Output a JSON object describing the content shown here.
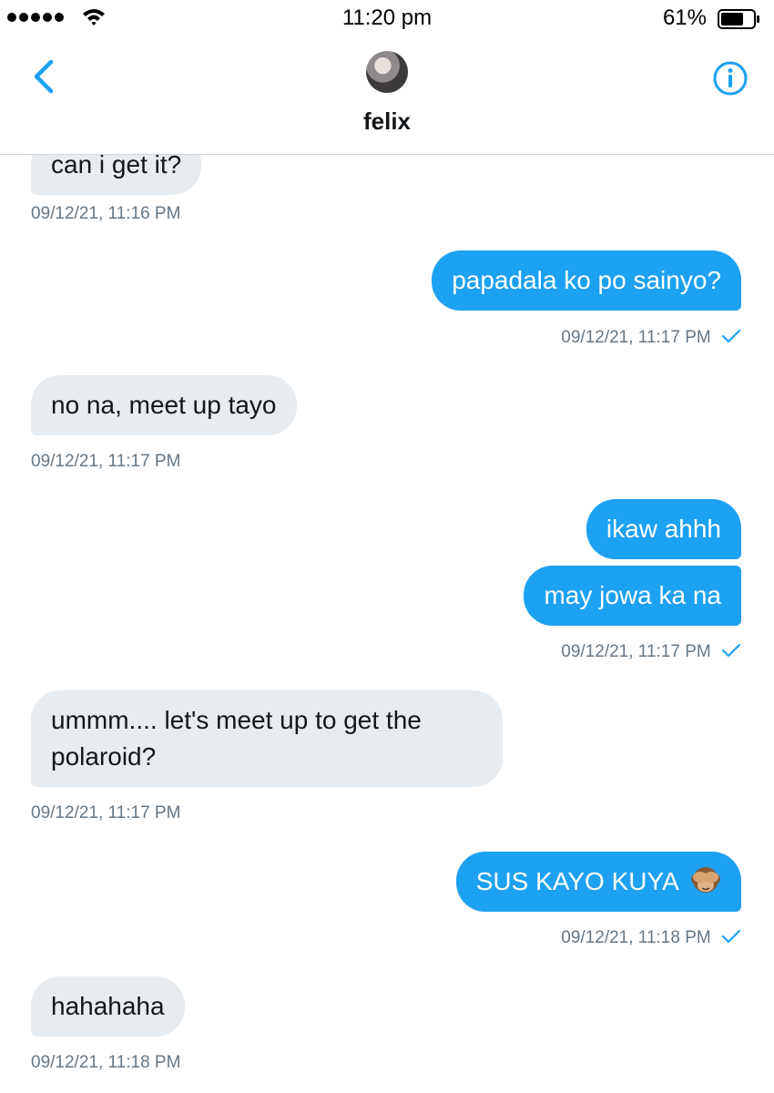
{
  "status_bar": {
    "time": "11:20 pm",
    "battery": "61%",
    "icons": [
      "signal-dots-icon",
      "wifi-icon",
      "battery-icon"
    ]
  },
  "header": {
    "contact_name": "felix",
    "icons": [
      "back-chevron-icon",
      "avatar",
      "info-icon"
    ]
  },
  "colors": {
    "accent": "#1da1f2",
    "incoming_bubble": "#e6ecf0",
    "timestamp": "#657786"
  },
  "messages": [
    {
      "direction": "in",
      "text": "can i get it?",
      "timestamp": "09/12/21, 11:16 PM"
    },
    {
      "direction": "out",
      "text": "papadala ko po sainyo?",
      "timestamp": "09/12/21, 11:17 PM",
      "status_icon": "check-icon"
    },
    {
      "direction": "in",
      "text": "no na, meet up tayo",
      "timestamp": "09/12/21, 11:17 PM"
    },
    {
      "direction": "out",
      "text": "ikaw ahhh"
    },
    {
      "direction": "out",
      "text": "may jowa ka na",
      "timestamp": "09/12/21, 11:17 PM",
      "status_icon": "check-icon"
    },
    {
      "direction": "in",
      "text_lines": [
        "ummm.... let's meet up to get the",
        "polaroid?"
      ],
      "timestamp": "09/12/21, 11:17 PM"
    },
    {
      "direction": "out",
      "text": "SUS KAYO KUYA",
      "emoji": "see-no-evil-monkey-icon",
      "timestamp": "09/12/21, 11:18 PM",
      "status_icon": "check-icon"
    },
    {
      "direction": "in",
      "text": "hahahaha",
      "timestamp": "09/12/21, 11:18 PM"
    }
  ]
}
